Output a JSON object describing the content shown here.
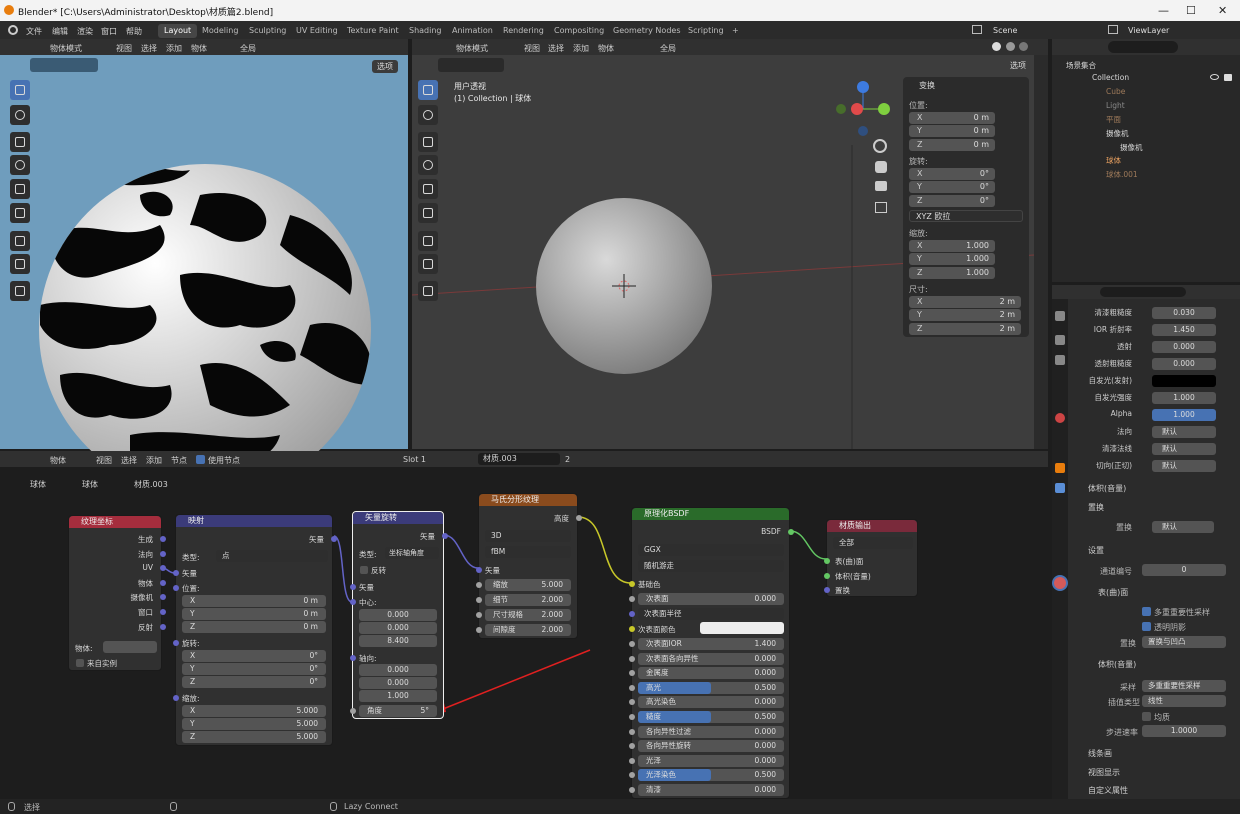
{
  "window": {
    "title": "Blender* [C:\\Users\\Administrator\\Desktop\\材质篇2.blend]"
  },
  "menu": [
    "文件",
    "编辑",
    "渲染",
    "窗口",
    "帮助"
  ],
  "workspaces": [
    "Layout",
    "Modeling",
    "Sculpting",
    "UV Editing",
    "Texture Paint",
    "Shading",
    "Animation",
    "Rendering",
    "Compositing",
    "Geometry Nodes",
    "Scripting",
    "+"
  ],
  "scene": "Scene",
  "viewlayer": "ViewLayer",
  "left_viewport": {
    "mode": "物体模式",
    "menus": [
      "视图",
      "选择",
      "添加",
      "物体"
    ],
    "global": "全局",
    "options": "选项"
  },
  "right_viewport": {
    "mode": "物体模式",
    "menus": [
      "视图",
      "选择",
      "添加",
      "物体"
    ],
    "global": "全局",
    "options": "选项",
    "view_name": "用户透视",
    "collection_label": "(1) Collection | 球体"
  },
  "transform": {
    "title": "变换",
    "location_label": "位置:",
    "rotation_label": "旋转:",
    "scale_label": "缩放:",
    "dims_label": "尺寸:",
    "loc": [
      "0 m",
      "0 m",
      "0 m"
    ],
    "rot": [
      "0°",
      "0°",
      "0°"
    ],
    "rot_mode": "XYZ 欧拉",
    "scale": [
      "1.000",
      "1.000",
      "1.000"
    ],
    "dims": [
      "2 m",
      "2 m",
      "2 m"
    ],
    "axes": [
      "X",
      "Y",
      "Z"
    ]
  },
  "outliner": {
    "items": [
      {
        "name": "场景集合"
      },
      {
        "name": "Collection"
      },
      {
        "name": "Cube"
      },
      {
        "name": "Light"
      },
      {
        "name": "平面"
      },
      {
        "name": "摄像机"
      },
      {
        "name": "摄像机"
      },
      {
        "name": "球体"
      },
      {
        "name": "球体.001"
      }
    ]
  },
  "node_header": {
    "menu": [
      "物体",
      "视图",
      "选择",
      "添加",
      "节点"
    ],
    "use_nodes": "使用节点",
    "slot": "Slot 1",
    "material": "材质.003",
    "users": "2",
    "breadcrumb": [
      "球体",
      "球体",
      "材质.003"
    ]
  },
  "nodes": {
    "texcoord": {
      "title": "纹理坐标",
      "outs": [
        "生成",
        "法向",
        "UV",
        "物体",
        "摄像机",
        "窗口",
        "反射"
      ],
      "obj_label": "物体:",
      "from_instance": "来自实例"
    },
    "mapping": {
      "title": "映射",
      "out": "矢量",
      "type_label": "类型:",
      "type": "点",
      "in_vec": "矢量",
      "loc_label": "位置:",
      "rot_label": "旋转:",
      "scale_label": "缩放:",
      "loc": [
        "0 m",
        "0 m",
        "0 m"
      ],
      "rot": [
        "0°",
        "0°",
        "0°"
      ],
      "scale": [
        "5.000",
        "5.000",
        "5.000"
      ]
    },
    "vrot": {
      "title": "矢量旋转",
      "out": "矢量",
      "type_label": "类型:",
      "type": "坐标轴角度",
      "invert": "反转",
      "in_vec": "矢量",
      "center_label": "中心:",
      "center": [
        "0.000",
        "0.000",
        "8.400"
      ],
      "axis_label": "轴向:",
      "axis": [
        "0.000",
        "0.000",
        "1.000"
      ],
      "angle_label": "角度",
      "angle": "5°"
    },
    "musgrave": {
      "title": "马氏分形纹理",
      "out": "高度",
      "dim": "3D",
      "type": "fBM",
      "in_vec": "矢量",
      "fields": [
        {
          "l": "缩放",
          "v": "5.000"
        },
        {
          "l": "细节",
          "v": "2.000"
        },
        {
          "l": "尺寸规格",
          "v": "2.000"
        },
        {
          "l": "间隙度",
          "v": "2.000"
        }
      ]
    },
    "bsdf": {
      "title": "原理化BSDF",
      "out": "BSDF",
      "dist": "GGX",
      "sss": "随机游走",
      "base": "基础色",
      "color_label": "次表面颜色",
      "radius": "次表面半径",
      "fields": [
        {
          "l": "次表面",
          "v": "0.000"
        },
        {
          "l": "次表面IOR",
          "v": "1.400"
        },
        {
          "l": "次表面各向异性",
          "v": "0.000"
        },
        {
          "l": "金属度",
          "v": "0.000"
        },
        {
          "l": "高光",
          "v": "0.500",
          "fill": 0.5
        },
        {
          "l": "高光染色",
          "v": "0.000"
        },
        {
          "l": "糙度",
          "v": "0.500",
          "fill": 0.5
        },
        {
          "l": "各向异性过滤",
          "v": "0.000"
        },
        {
          "l": "各向异性旋转",
          "v": "0.000"
        },
        {
          "l": "光泽",
          "v": "0.000"
        },
        {
          "l": "光泽染色",
          "v": "0.500",
          "fill": 0.5
        },
        {
          "l": "清漆",
          "v": "0.000"
        }
      ]
    },
    "output": {
      "title": "材质输出",
      "target": "全部",
      "ins": [
        "表(曲)面",
        "体积(音量)",
        "置换"
      ]
    }
  },
  "props": {
    "rows": [
      {
        "l": "清漆粗糙度",
        "v": "0.030"
      },
      {
        "l": "IOR 折射率",
        "v": "1.450"
      },
      {
        "l": "透射",
        "v": "0.000"
      },
      {
        "l": "透射粗糙度",
        "v": "0.000"
      },
      {
        "l": "自发光(发射)",
        "v": ""
      },
      {
        "l": "自发光强度",
        "v": "1.000"
      },
      {
        "l": "Alpha",
        "v": "1.000"
      },
      {
        "l": "法向",
        "v": "默认"
      },
      {
        "l": "清漆法线",
        "v": "默认"
      },
      {
        "l": "切向(正切)",
        "v": "默认"
      }
    ],
    "vol_section": "体积(音量)",
    "disp_section": "置换",
    "disp_label": "置换",
    "disp_val": "默认",
    "settings": "设置",
    "pass_label": "通道编号",
    "pass_val": "0",
    "surface": "表(曲)面",
    "mis": "多重重要性采样",
    "transparent_shadow": "透明阴影",
    "disp_mode_label": "置换",
    "disp_mode": "置换与凹凸",
    "volume": "体积(音量)",
    "sampling_label": "采样",
    "sampling": "多重重要性采样",
    "interp_label": "插值类型",
    "interp": "线性",
    "homogeneous": "均质",
    "step_label": "步进速率",
    "step": "1.0000",
    "lineart": "线条画",
    "viewport_display": "视图显示",
    "custom_props": "自定义属性"
  },
  "status": {
    "select": "选择",
    "lazy": "Lazy Connect"
  }
}
